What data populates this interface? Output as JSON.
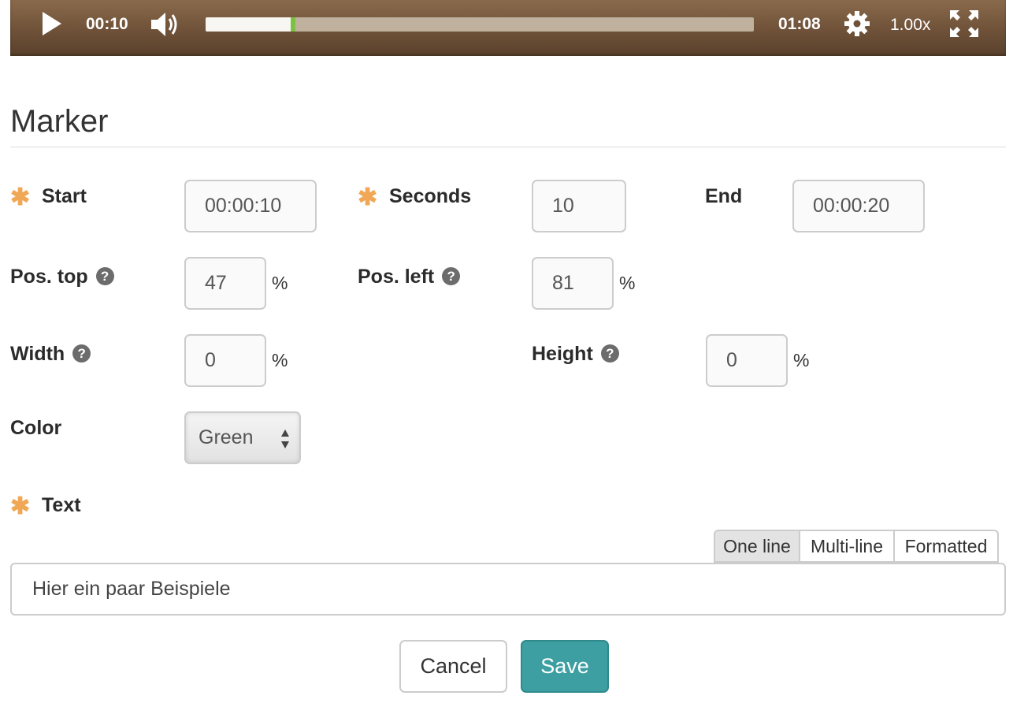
{
  "player": {
    "current_time": "00:10",
    "duration": "01:08",
    "playback_rate": "1.00x",
    "progress_fraction": 0.155,
    "colors": {
      "bar": "#6e5138",
      "track": "#bfb19e",
      "played": "#f8f6f2",
      "head": "#7cc242"
    }
  },
  "section": {
    "title": "Marker"
  },
  "fields": {
    "start": {
      "label": "Start",
      "value": "00:00:10",
      "required_mark": "✱"
    },
    "seconds": {
      "label": "Seconds",
      "value": "10",
      "required_mark": "✱"
    },
    "end": {
      "label": "End",
      "value": "00:00:20"
    },
    "pos_top": {
      "label": "Pos. top",
      "value": "47",
      "unit": "%",
      "help": "?"
    },
    "pos_left": {
      "label": "Pos. left",
      "value": "81",
      "unit": "%",
      "help": "?"
    },
    "width": {
      "label": "Width",
      "value": "0",
      "unit": "%",
      "help": "?"
    },
    "height": {
      "label": "Height",
      "value": "0",
      "unit": "%",
      "help": "?"
    },
    "color": {
      "label": "Color",
      "selected": "Green"
    },
    "text": {
      "label": "Text",
      "required_mark": "✱",
      "value": "Hier ein paar Beispiele",
      "modes": [
        "One line",
        "Multi-line",
        "Formatted"
      ],
      "active_mode": "One line"
    }
  },
  "actions": {
    "cancel": "Cancel",
    "save": "Save"
  },
  "colors": {
    "required": "#f0a856",
    "save_button": "#3e9fa3"
  }
}
